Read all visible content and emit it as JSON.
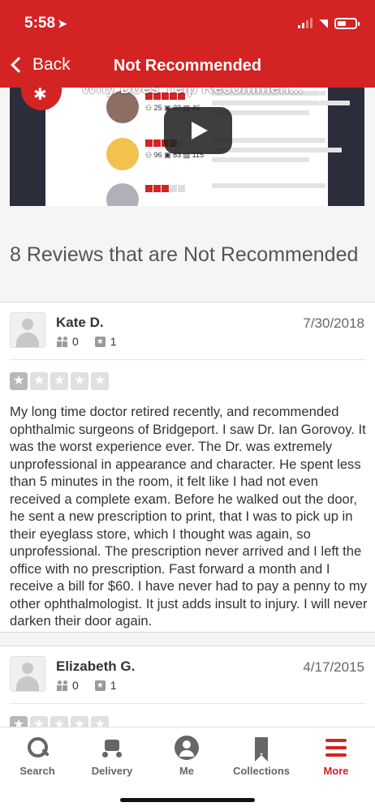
{
  "status_bar": {
    "time": "5:58",
    "signal_bars": 2,
    "battery_level": 0.5
  },
  "nav": {
    "back_label": "Back",
    "title": "Not Recommended"
  },
  "video": {
    "title": "Why Does Yelp Recommen...",
    "rows": [
      {
        "stars": 5,
        "friends": "25",
        "reviews": "32",
        "photos": "46"
      },
      {
        "stars": 4,
        "friends": "96",
        "reviews": "83",
        "photos": "115"
      },
      {
        "stars": 3
      }
    ]
  },
  "section_title": "8 Reviews that are Not Recommended",
  "reviews": [
    {
      "name": "Kate D.",
      "date": "7/30/2018",
      "friends": "0",
      "review_count": "1",
      "rating": 1,
      "text": "My long time doctor retired recently, and recommended ophthalmic surgeons of Bridgeport. I saw Dr. Ian Gorovoy. It was the worst experience ever. The Dr. was extremely unprofessional in appearance and character. He spent less than 5 minutes in the room, it felt like I had not even received a complete exam. Before he walked out the door, he sent a new prescription to print, that I was to pick up in their eyeglass store, which I thought was again, so unprofessional. The prescription never arrived and I left the office with no prescription. Fast forward a month and I receive a bill for $60. I have never had to pay a penny to my other ophthalmologist. It just adds insult to injury. I will never darken their door again."
    },
    {
      "name": "Elizabeth G.",
      "date": "4/17/2015",
      "friends": "0",
      "review_count": "1",
      "rating": 1
    }
  ],
  "tabs": [
    {
      "label": "Search",
      "icon": "search-icon"
    },
    {
      "label": "Delivery",
      "icon": "delivery-icon"
    },
    {
      "label": "Me",
      "icon": "me-icon"
    },
    {
      "label": "Collections",
      "icon": "collections-icon"
    },
    {
      "label": "More",
      "icon": "menu-icon"
    }
  ],
  "colors": {
    "brand": "#d32323",
    "star_filled": "#b8b8b8",
    "star_empty": "#e0e0e0"
  }
}
